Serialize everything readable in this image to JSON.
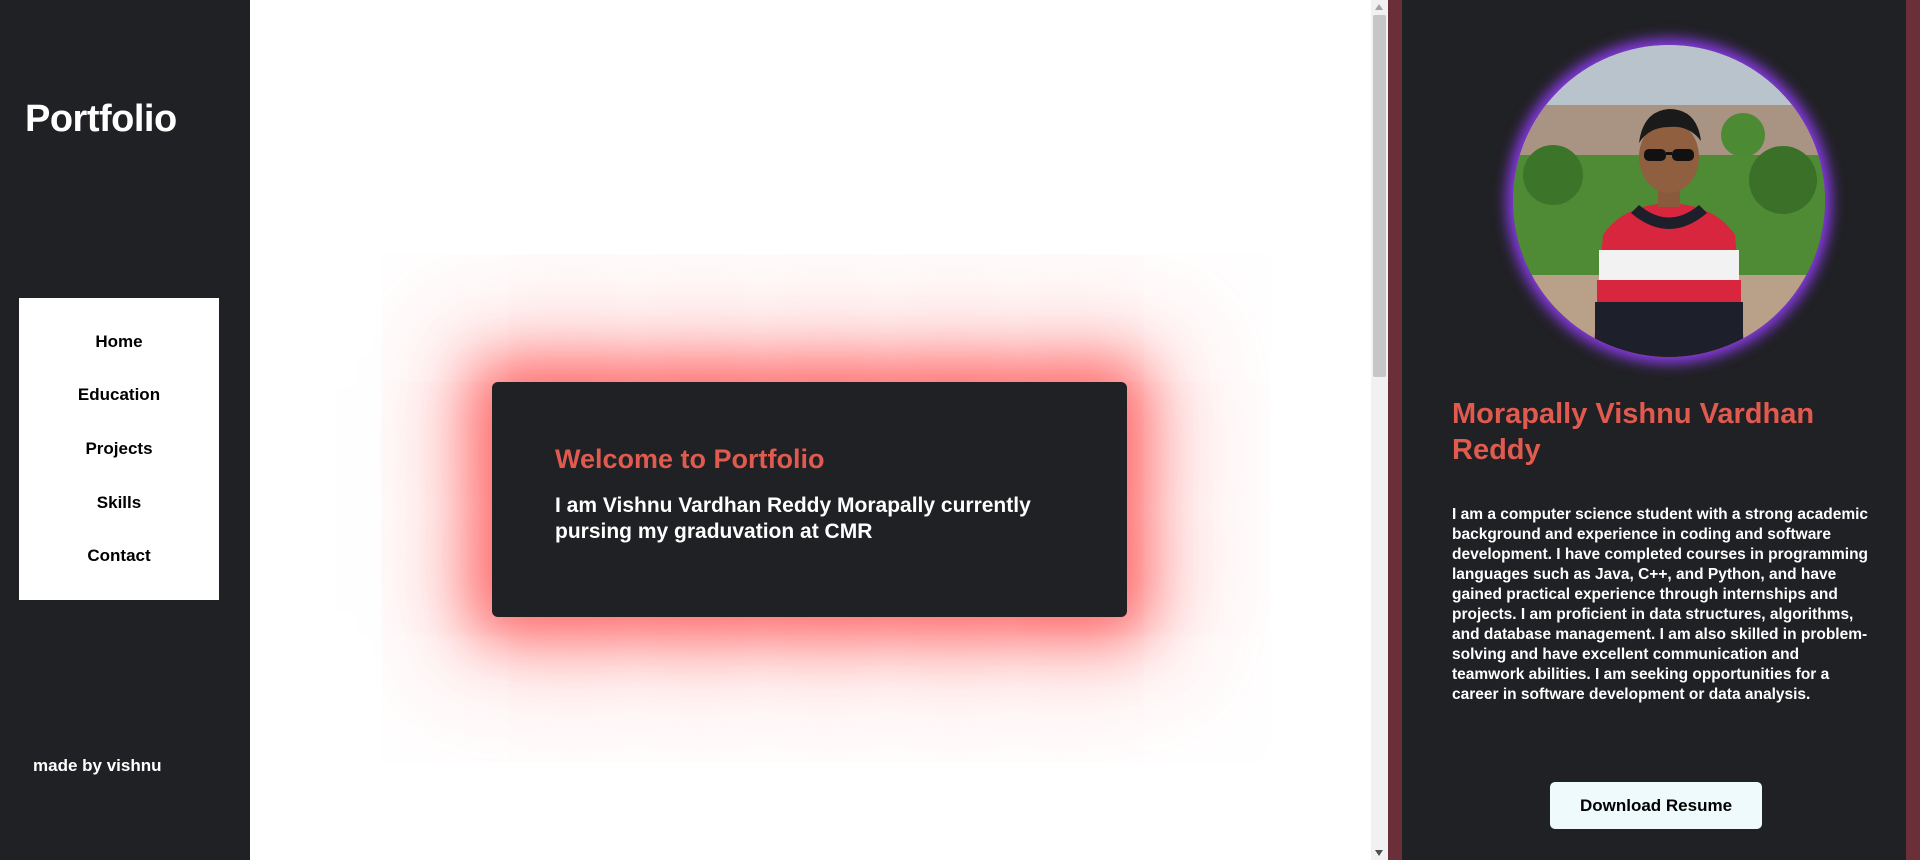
{
  "sidebar": {
    "brand": "Portfolio",
    "nav": [
      {
        "label": "Home"
      },
      {
        "label": "Education"
      },
      {
        "label": "Projects"
      },
      {
        "label": "Skills"
      },
      {
        "label": "Contact"
      }
    ],
    "credit": "made by vishnu"
  },
  "main": {
    "welcome_title": "Welcome to Portfolio",
    "welcome_text": "I am Vishnu Vardhan Reddy Morapally currently pursing my graduvation at CMR"
  },
  "profile": {
    "name": "Morapally Vishnu Vardhan Reddy",
    "bio": "I am a computer science student with a strong academic background and experience in coding and software development. I have completed courses in programming languages such as Java, C++, and Python, and have gained practical experience through internships and projects. I am proficient in data structures, algorithms, and database management. I am also skilled in problem-solving and have excellent communication and teamwork abilities. I am seeking opportunities for a career in software development or data analysis.",
    "resume_button": "Download Resume"
  },
  "colors": {
    "dark_bg": "#202124",
    "accent_red": "#e05a4f",
    "glow_red": "#ff3c3c",
    "panel_border": "#6b2f3a",
    "avatar_glow": "#8e3cf0"
  },
  "icons": {
    "avatar": "profile-photo"
  }
}
